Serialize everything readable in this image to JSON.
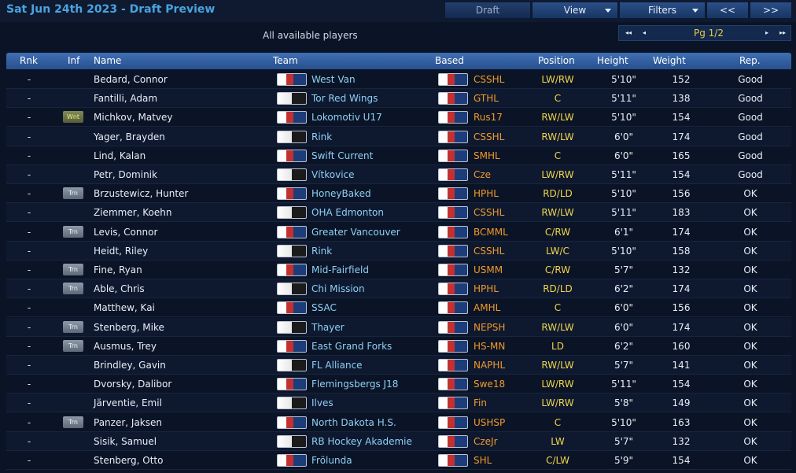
{
  "header": {
    "title": "Sat Jun 24th 2023 - Draft Preview",
    "buttons": {
      "draft": "Draft",
      "view": "View",
      "filters": "Filters",
      "prev": "<<",
      "next": ">>"
    }
  },
  "subtitle": "All available players",
  "pager": {
    "first": "◂◂",
    "prev": "◂",
    "label": "Pg 1/2",
    "next": "▸",
    "last": "▸▸"
  },
  "columns": {
    "rnk": "Rnk",
    "inf": "Inf",
    "name": "Name",
    "team": "Team",
    "based": "Based",
    "position": "Position",
    "height": "Height",
    "weight": "Weight",
    "rep": "Rep."
  },
  "rows": [
    {
      "rnk": "-",
      "inf": "",
      "name": "Bedard, Connor",
      "team": "West Van",
      "based": "CSSHL",
      "position": "LW/RW",
      "height": "5'10\"",
      "weight": "152",
      "rep": "Good"
    },
    {
      "rnk": "-",
      "inf": "",
      "name": "Fantilli, Adam",
      "team": "Tor Red Wings",
      "based": "GTHL",
      "position": "C",
      "height": "5'11\"",
      "weight": "138",
      "rep": "Good"
    },
    {
      "rnk": "-",
      "inf": "Wnt",
      "name": "Michkov, Matvey",
      "team": "Lokomotiv U17",
      "based": "Rus17",
      "position": "RW/LW",
      "height": "5'10\"",
      "weight": "154",
      "rep": "Good"
    },
    {
      "rnk": "-",
      "inf": "",
      "name": "Yager, Brayden",
      "team": "Rink",
      "based": "CSSHL",
      "position": "RW/LW",
      "height": "6'0\"",
      "weight": "174",
      "rep": "Good"
    },
    {
      "rnk": "-",
      "inf": "",
      "name": "Lind, Kalan",
      "team": "Swift Current",
      "based": "SMHL",
      "position": "C",
      "height": "6'0\"",
      "weight": "165",
      "rep": "Good"
    },
    {
      "rnk": "-",
      "inf": "",
      "name": "Petr, Dominik",
      "team": "Vítkovice",
      "based": "Cze",
      "position": "LW/RW",
      "height": "5'11\"",
      "weight": "154",
      "rep": "Good"
    },
    {
      "rnk": "-",
      "inf": "Trn",
      "name": "Brzustewicz, Hunter",
      "team": "HoneyBaked",
      "based": "HPHL",
      "position": "RD/LD",
      "height": "5'10\"",
      "weight": "156",
      "rep": "OK"
    },
    {
      "rnk": "-",
      "inf": "",
      "name": "Ziemmer, Koehn",
      "team": "OHA Edmonton",
      "based": "CSSHL",
      "position": "RW/LW",
      "height": "5'11\"",
      "weight": "183",
      "rep": "OK"
    },
    {
      "rnk": "-",
      "inf": "Trn",
      "name": "Levis, Connor",
      "team": "Greater Vancouver",
      "based": "BCMML",
      "position": "C/RW",
      "height": "6'1\"",
      "weight": "174",
      "rep": "OK"
    },
    {
      "rnk": "-",
      "inf": "",
      "name": "Heidt, Riley",
      "team": "Rink",
      "based": "CSSHL",
      "position": "LW/C",
      "height": "5'10\"",
      "weight": "158",
      "rep": "OK"
    },
    {
      "rnk": "-",
      "inf": "Trn",
      "name": "Fine, Ryan",
      "team": "Mid-Fairfield",
      "based": "USMM",
      "position": "C/RW",
      "height": "5'7\"",
      "weight": "132",
      "rep": "OK"
    },
    {
      "rnk": "-",
      "inf": "Trn",
      "name": "Able, Chris",
      "team": "Chi Mission",
      "based": "HPHL",
      "position": "RD/LD",
      "height": "6'2\"",
      "weight": "174",
      "rep": "OK"
    },
    {
      "rnk": "-",
      "inf": "",
      "name": "Matthew, Kai",
      "team": "SSAC",
      "based": "AMHL",
      "position": "C",
      "height": "6'0\"",
      "weight": "156",
      "rep": "OK"
    },
    {
      "rnk": "-",
      "inf": "Trn",
      "name": "Stenberg, Mike",
      "team": "Thayer",
      "based": "NEPSH",
      "position": "RW/LW",
      "height": "6'0\"",
      "weight": "174",
      "rep": "OK"
    },
    {
      "rnk": "-",
      "inf": "Trn",
      "name": "Ausmus, Trey",
      "team": "East Grand Forks",
      "based": "HS-MN",
      "position": "LD",
      "height": "6'2\"",
      "weight": "160",
      "rep": "OK"
    },
    {
      "rnk": "-",
      "inf": "",
      "name": "Brindley, Gavin",
      "team": "FL Alliance",
      "based": "NAPHL",
      "position": "RW/LW",
      "height": "5'7\"",
      "weight": "141",
      "rep": "OK"
    },
    {
      "rnk": "-",
      "inf": "",
      "name": "Dvorsky, Dalibor",
      "team": "Flemingsbergs J18",
      "based": "Swe18",
      "position": "LW/RW",
      "height": "5'11\"",
      "weight": "154",
      "rep": "OK"
    },
    {
      "rnk": "-",
      "inf": "",
      "name": "Järventie, Emil",
      "team": "Ilves",
      "based": "Fin",
      "position": "LW/RW",
      "height": "5'8\"",
      "weight": "149",
      "rep": "OK"
    },
    {
      "rnk": "-",
      "inf": "Trn",
      "name": "Panzer, Jaksen",
      "team": "North Dakota H.S.",
      "based": "USHSP",
      "position": "C",
      "height": "5'10\"",
      "weight": "163",
      "rep": "OK"
    },
    {
      "rnk": "-",
      "inf": "",
      "name": "Sisik, Samuel",
      "team": "RB Hockey Akademie",
      "based": "CzeJr",
      "position": "LW",
      "height": "5'7\"",
      "weight": "132",
      "rep": "OK"
    },
    {
      "rnk": "-",
      "inf": "",
      "name": "Stenberg, Otto",
      "team": "Frölunda",
      "based": "SHL",
      "position": "C/LW",
      "height": "5'9\"",
      "weight": "154",
      "rep": "OK"
    }
  ]
}
